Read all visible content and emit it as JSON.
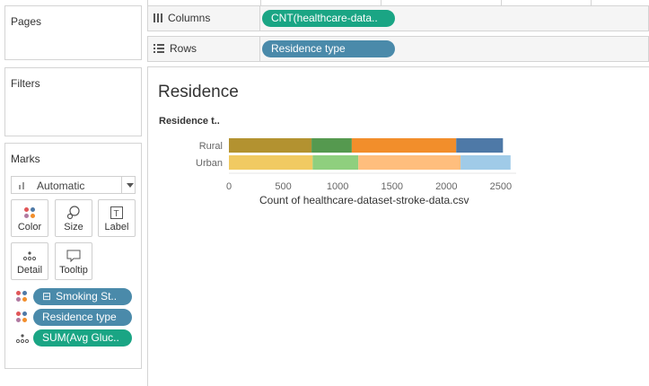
{
  "sidebar": {
    "pages_title": "Pages",
    "filters_title": "Filters",
    "marks_title": "Marks",
    "mark_type": "Automatic",
    "buttons": [
      {
        "label": "Color",
        "icon": "color-icon"
      },
      {
        "label": "Size",
        "icon": "size-icon"
      },
      {
        "label": "Label",
        "icon": "label-icon"
      },
      {
        "label": "Detail",
        "icon": "detail-icon"
      },
      {
        "label": "Tooltip",
        "icon": "tooltip-icon"
      }
    ],
    "mark_pills": [
      {
        "label": "Smoking St..",
        "icon": "color-icon",
        "minus": "⊟"
      },
      {
        "label": "Residence type",
        "icon": "color-icon"
      },
      {
        "label": "SUM(Avg Gluc..",
        "icon": "detail-icon"
      }
    ]
  },
  "shelves": {
    "columns_label": "Columns",
    "columns_pill": "CNT(healthcare-data..",
    "rows_label": "Rows",
    "rows_pill": "Residence type"
  },
  "viz": {
    "title": "Residence",
    "row_header": "Residence t..",
    "axis_title": "Count of healthcare-dataset-stroke-data.csv"
  },
  "chart_data": {
    "type": "bar",
    "orientation": "horizontal",
    "stacked": true,
    "categories": [
      "Rural",
      "Urban"
    ],
    "series": [
      {
        "values": [
          760,
          770
        ],
        "colors": [
          "#b39230",
          "#f1ca62"
        ]
      },
      {
        "values": [
          370,
          420
        ],
        "colors": [
          "#55994f",
          "#8fcf7e"
        ]
      },
      {
        "values": [
          960,
          940
        ],
        "colors": [
          "#f28e2b",
          "#ffbe7d"
        ]
      },
      {
        "values": [
          430,
          460
        ],
        "colors": [
          "#4e79a7",
          "#a0cbe8"
        ]
      }
    ],
    "xticks": [
      0,
      500,
      1000,
      1500,
      2000,
      2500
    ],
    "xlim": [
      0,
      2600
    ],
    "xlabel": "Count of healthcare-dataset-stroke-data.csv",
    "ylabel": "Residence t..",
    "grid": false
  }
}
